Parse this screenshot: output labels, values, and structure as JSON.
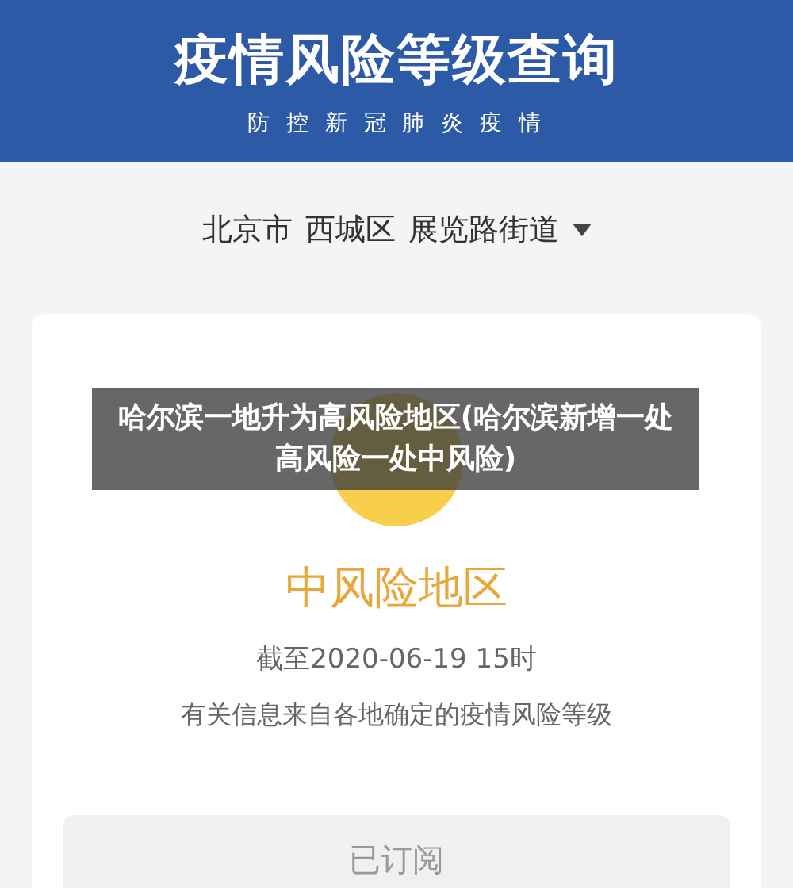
{
  "header": {
    "title": "疫情风险等级查询",
    "subtitle": "防 控 新 冠 肺 炎 疫 情"
  },
  "location": {
    "parts": [
      "北京市",
      "西城区",
      "展览路街道"
    ]
  },
  "result": {
    "level_label": "中风险地区",
    "as_of": "截至2020-06-19 15时",
    "note": "有关信息来自各地确定的疫情风险等级"
  },
  "subscribe_button": {
    "label": "已订阅"
  },
  "caption_overlay": {
    "text": "哈尔滨一地升为高风险地区(哈尔滨新增一处高风险一处中风险)"
  }
}
